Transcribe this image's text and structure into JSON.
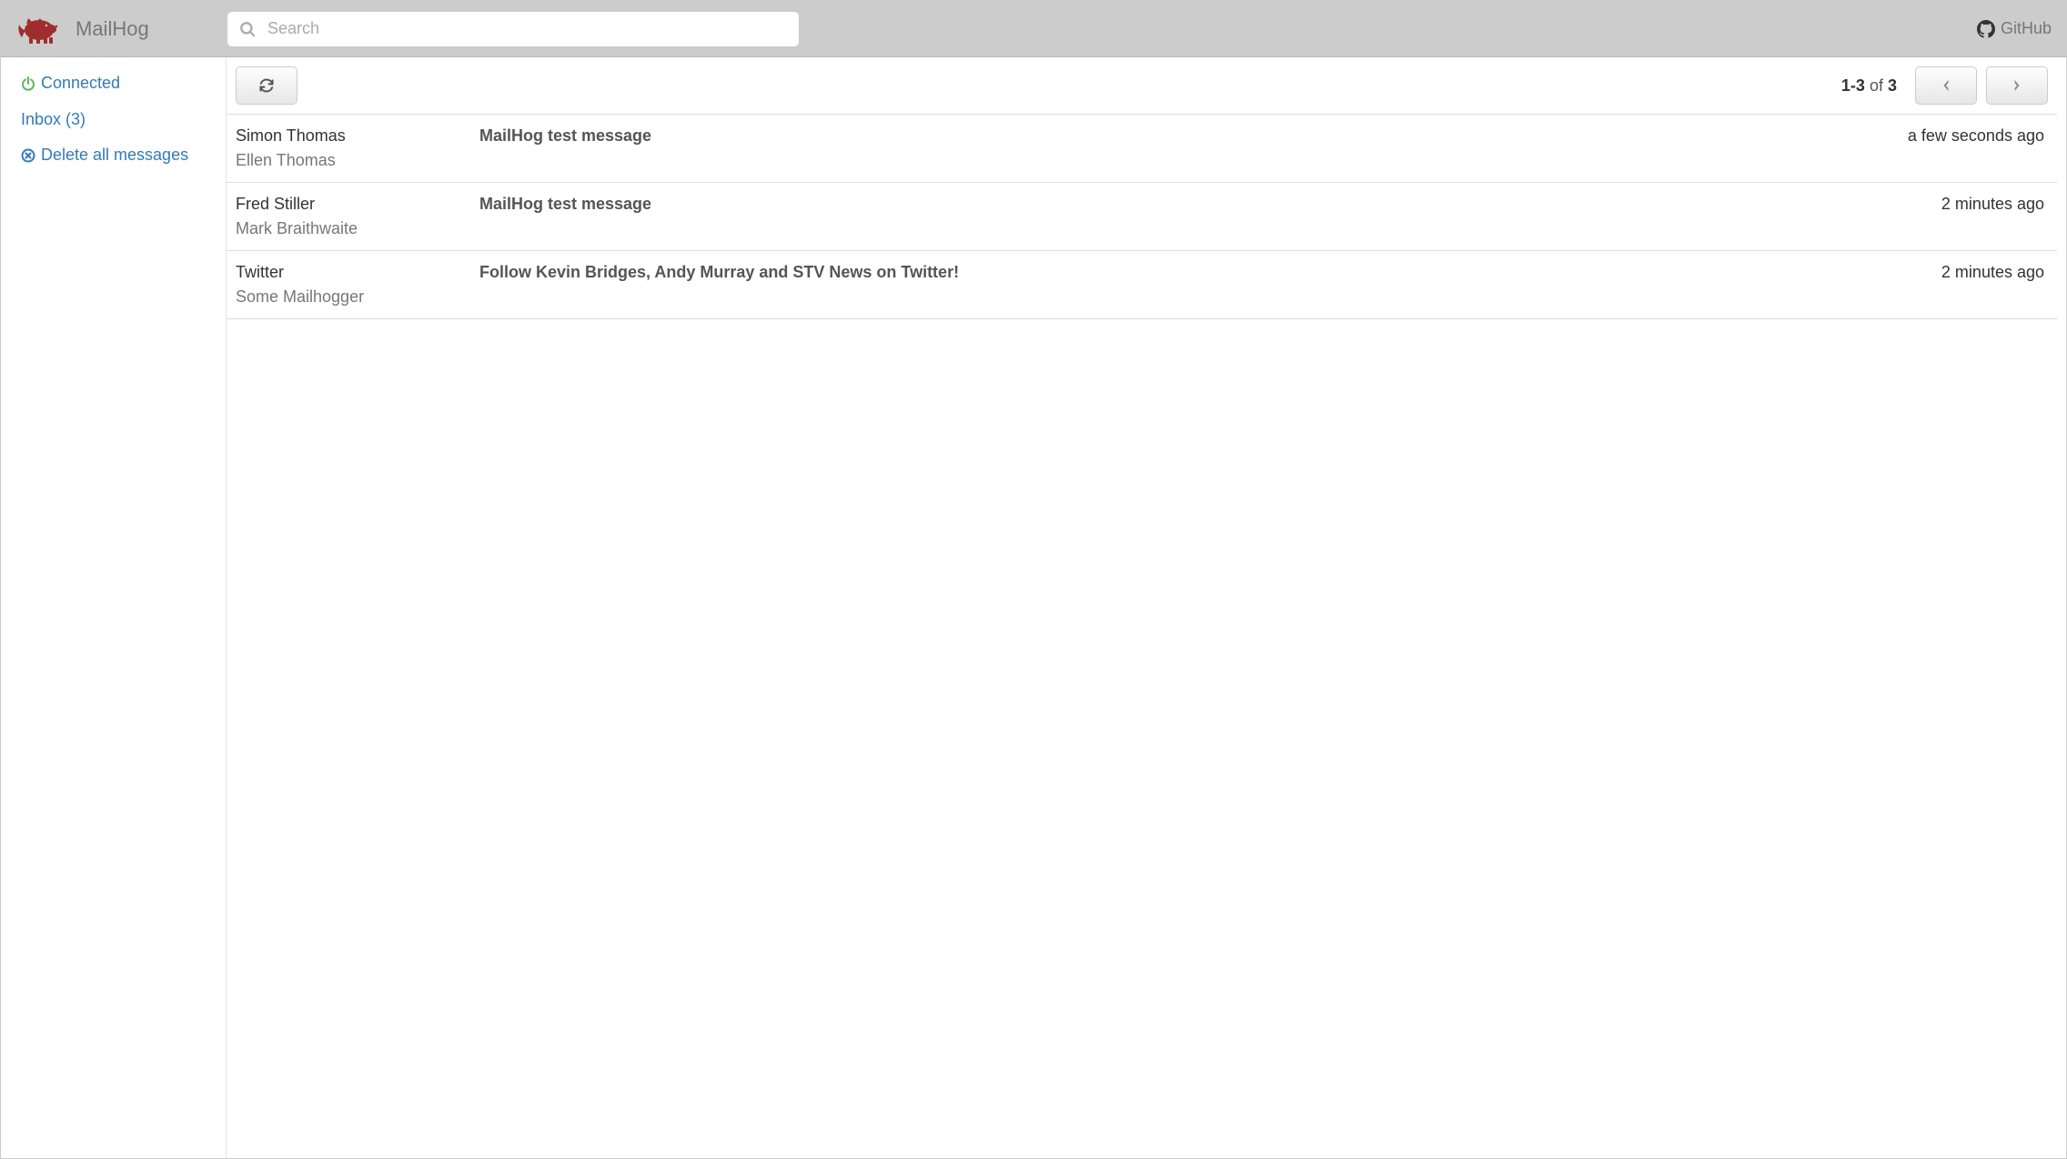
{
  "header": {
    "app_name": "MailHog",
    "search_placeholder": "Search",
    "github_label": "GitHub"
  },
  "sidebar": {
    "connected_label": "Connected",
    "inbox_label": "Inbox (3)",
    "delete_all_label": "Delete all messages"
  },
  "toolbar": {
    "pager_range": "1-3",
    "pager_of": "of",
    "pager_total": "3"
  },
  "messages": [
    {
      "from": "Simon Thomas",
      "to": "Ellen Thomas",
      "subject": "MailHog test message",
      "time": "a few seconds ago"
    },
    {
      "from": "Fred Stiller",
      "to": "Mark Braithwaite",
      "subject": "MailHog test message",
      "time": "2 minutes ago"
    },
    {
      "from": "Twitter",
      "to": "Some Mailhogger",
      "subject": "Follow Kevin Bridges, Andy Murray and STV News on Twitter!",
      "time": "2 minutes ago"
    }
  ]
}
